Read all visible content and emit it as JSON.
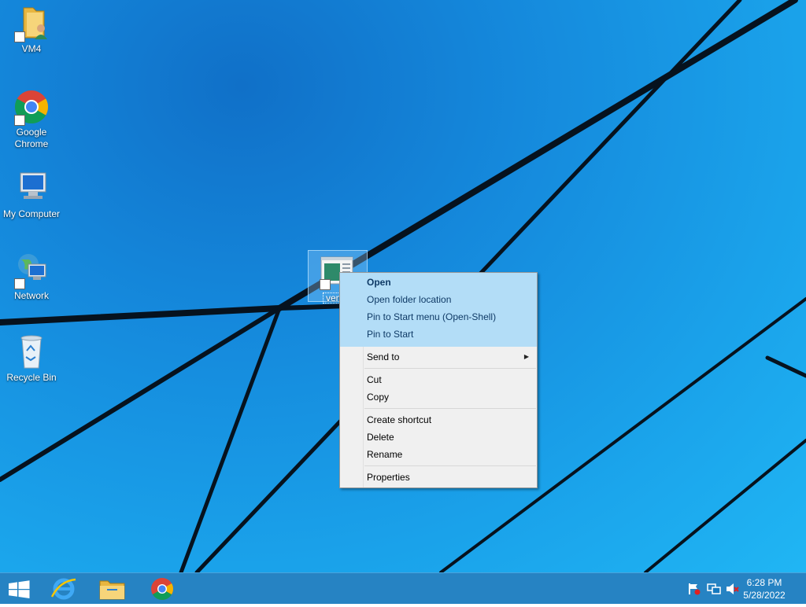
{
  "desktop": {
    "icons": [
      {
        "label": "VM4",
        "icon": "user-folder-icon"
      },
      {
        "label": "Google Chrome",
        "icon": "chrome-icon"
      },
      {
        "label": "My Computer",
        "icon": "computer-icon"
      },
      {
        "label": "Network",
        "icon": "network-icon"
      },
      {
        "label": "Recycle Bin",
        "icon": "recycle-bin-icon"
      }
    ],
    "selected_icon": {
      "label": "venus",
      "icon": "window-app-icon"
    }
  },
  "context_menu": {
    "items": [
      {
        "label": "Open"
      },
      {
        "label": "Open folder location"
      },
      {
        "label": "Pin to Start menu (Open-Shell)"
      },
      {
        "label": "Pin to Start"
      },
      {
        "label": "Send to"
      },
      {
        "label": "Cut"
      },
      {
        "label": "Copy"
      },
      {
        "label": "Create shortcut"
      },
      {
        "label": "Delete"
      },
      {
        "label": "Rename"
      },
      {
        "label": "Properties"
      }
    ]
  },
  "taskbar": {
    "pinned": [
      "windows-start-icon",
      "internet-explorer-icon",
      "file-explorer-icon",
      "chrome-icon"
    ],
    "tray": [
      "action-center-flag-icon",
      "network-tray-icon",
      "volume-muted-icon"
    ],
    "clock": {
      "time": "6:28 PM",
      "date": "5/28/2022"
    }
  },
  "colors": {
    "accent": "#1a9fe8",
    "taskbar": "#1478be",
    "menu_highlight": "#9bd6fa"
  }
}
